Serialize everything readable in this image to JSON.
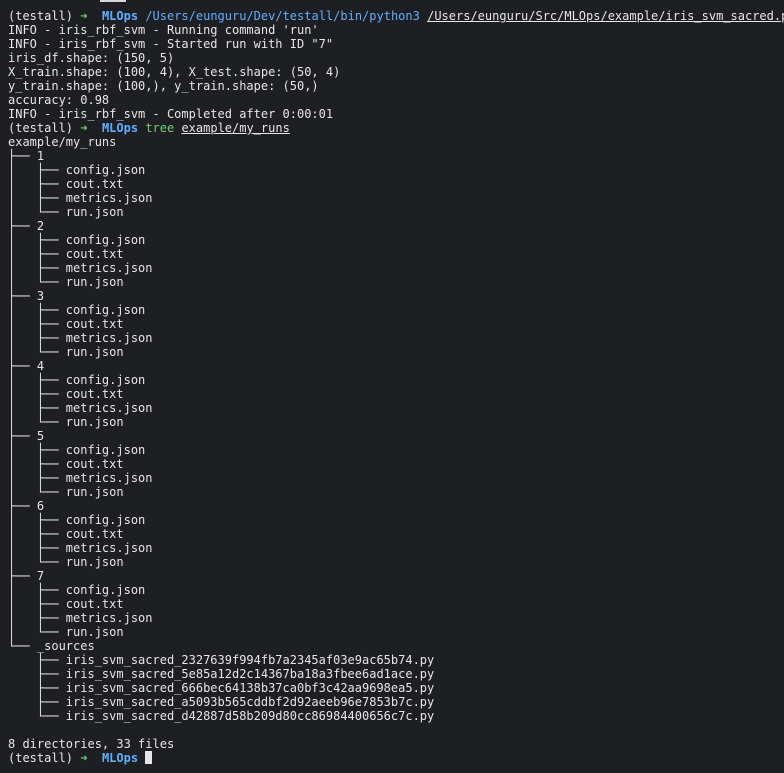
{
  "prompt": {
    "env": "(testall)",
    "arrow": "➜",
    "dir": "MLOps"
  },
  "command1": {
    "python": "/Users/eunguru/Dev/testall/bin/python3",
    "script": "/Users/eunguru/Src/MLOps/example/iris_svm_sacred.py"
  },
  "output": [
    "INFO - iris_rbf_svm - Running command 'run'",
    "INFO - iris_rbf_svm - Started run with ID \"7\"",
    "iris_df.shape: (150, 5)",
    "X_train.shape: (100, 4), X_test.shape: (50, 4)",
    "y_train.shape: (100,), y_train.shape: (50,)",
    "accuracy: 0.98",
    "INFO - iris_rbf_svm - Completed after 0:00:01"
  ],
  "command2": {
    "cmd": "tree",
    "arg": "example/my_runs"
  },
  "tree": [
    "example/my_runs",
    "├── 1",
    "│   ├── config.json",
    "│   ├── cout.txt",
    "│   ├── metrics.json",
    "│   └── run.json",
    "├── 2",
    "│   ├── config.json",
    "│   ├── cout.txt",
    "│   ├── metrics.json",
    "│   └── run.json",
    "├── 3",
    "│   ├── config.json",
    "│   ├── cout.txt",
    "│   ├── metrics.json",
    "│   └── run.json",
    "├── 4",
    "│   ├── config.json",
    "│   ├── cout.txt",
    "│   ├── metrics.json",
    "│   └── run.json",
    "├── 5",
    "│   ├── config.json",
    "│   ├── cout.txt",
    "│   ├── metrics.json",
    "│   └── run.json",
    "├── 6",
    "│   ├── config.json",
    "│   ├── cout.txt",
    "│   ├── metrics.json",
    "│   └── run.json",
    "├── 7",
    "│   ├── config.json",
    "│   ├── cout.txt",
    "│   ├── metrics.json",
    "│   └── run.json",
    "└── _sources",
    "    ├── iris_svm_sacred_2327639f994fb7a2345af03e9ac65b74.py",
    "    ├── iris_svm_sacred_5e85a12d2c14367ba18a3fbee6ad1ace.py",
    "    ├── iris_svm_sacred_666bec64138b37ca0bf3c42aa9698ea5.py",
    "    ├── iris_svm_sacred_a5093b565cddbf2d92aeeb96e7853b7c.py",
    "    └── iris_svm_sacred_d42887d58b209d80cc86984400656c7c.py"
  ],
  "summary": "8 directories, 33 files",
  "colors": {
    "background": "#1e1f22",
    "foreground": "#e6e6e6",
    "arrow": "#6ad37a",
    "directory": "#5fb0ff"
  }
}
